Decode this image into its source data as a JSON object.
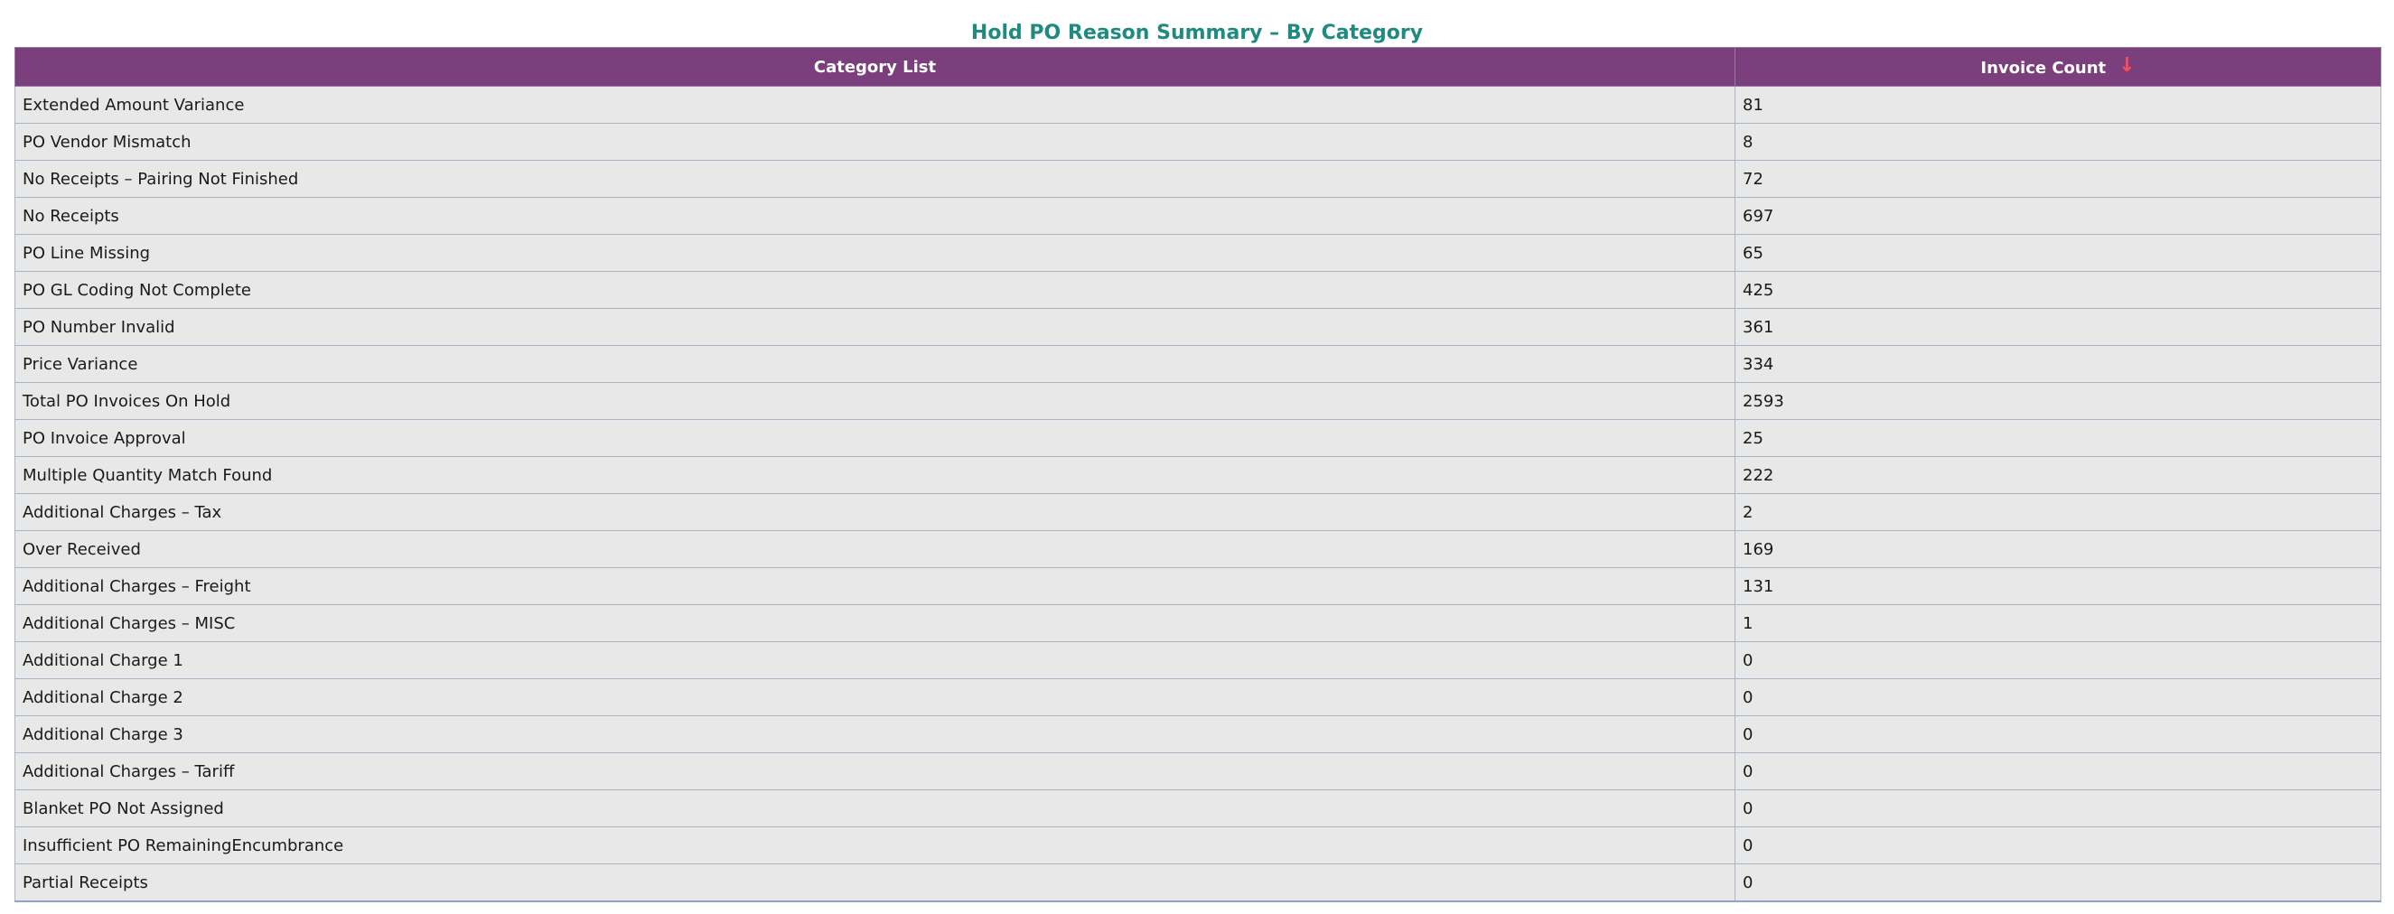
{
  "report": {
    "title": "Hold PO Reason Summary – By Category"
  },
  "table": {
    "headers": {
      "category": "Category List",
      "count": "Invoice Count",
      "sort_icon": "sort-descending-arrow",
      "sort_glyph": "↓"
    },
    "rows": [
      {
        "category": "Extended Amount Variance",
        "count": "81"
      },
      {
        "category": "PO Vendor Mismatch",
        "count": "8"
      },
      {
        "category": "No Receipts – Pairing Not Finished",
        "count": "72"
      },
      {
        "category": "No Receipts",
        "count": "697"
      },
      {
        "category": "PO Line Missing",
        "count": "65"
      },
      {
        "category": "PO GL Coding Not Complete",
        "count": "425"
      },
      {
        "category": "PO Number Invalid",
        "count": "361"
      },
      {
        "category": "Price Variance",
        "count": "334"
      },
      {
        "category": "Total PO Invoices On Hold",
        "count": "2593"
      },
      {
        "category": "PO Invoice Approval",
        "count": "25"
      },
      {
        "category": "Multiple Quantity Match Found",
        "count": "222"
      },
      {
        "category": "Additional Charges – Tax",
        "count": "2"
      },
      {
        "category": "Over Received",
        "count": "169"
      },
      {
        "category": "Additional Charges – Freight",
        "count": "131"
      },
      {
        "category": "Additional Charges – MISC",
        "count": "1"
      },
      {
        "category": "Additional Charge 1",
        "count": "0"
      },
      {
        "category": "Additional Charge 2",
        "count": "0"
      },
      {
        "category": "Additional Charge 3",
        "count": "0"
      },
      {
        "category": "Additional Charges – Tariff",
        "count": "0"
      },
      {
        "category": "Blanket PO Not Assigned",
        "count": "0"
      },
      {
        "category": "Insufficient PO RemainingEncumbrance",
        "count": "0"
      },
      {
        "category": "Partial Receipts",
        "count": "0"
      }
    ]
  },
  "colors": {
    "title": "#1f8a80",
    "header_bg": "#7b3f7e",
    "sort_arrow": "#ff4d5a",
    "row_bg": "#e8e8e8"
  }
}
